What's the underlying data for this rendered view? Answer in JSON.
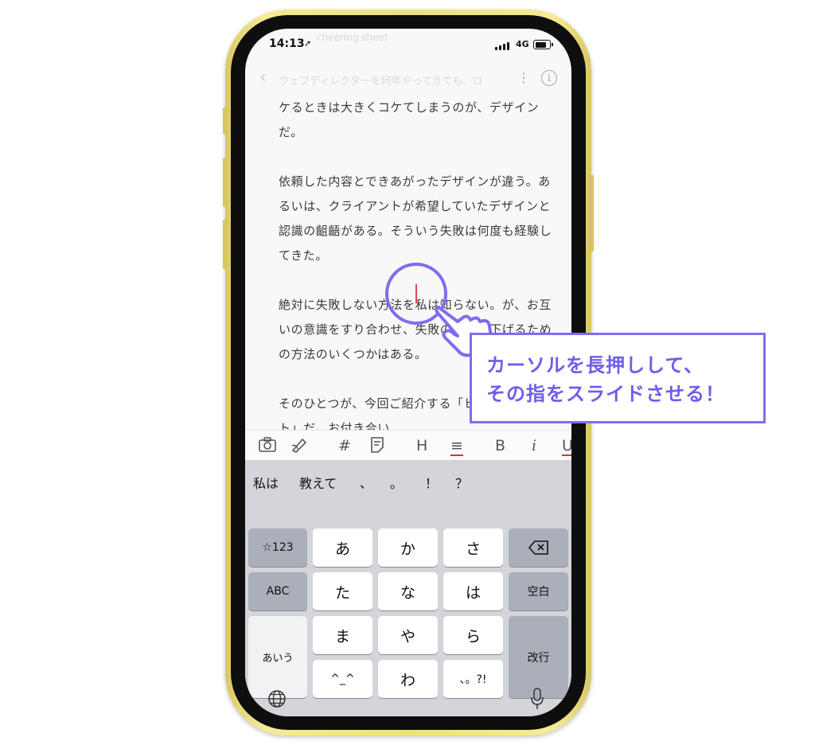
{
  "status_bar": {
    "time": "14:13",
    "network": "4G",
    "ghost_text": "cheering sheet"
  },
  "nav": {
    "title": "ウェブディレクターを何年やってきても、ロ"
  },
  "article": {
    "paragraphs": [
      "ケるときは大きくコケてしまうのが、デザインだ。",
      "依頼した内容とできあがったデザインが違う。あるいは、クライアントが希望していたデザインと認識の齟齬がある。そういう失敗は何度も経験してきた。",
      "絶対に失敗しない方法を私は知らない。が、お互いの意識をすり合わせ、失敗の確率を下げるための方法のいくつかはある。",
      "そのひとつが、今回ご紹介する「ヒアリングシート」だ。お付き合い"
    ]
  },
  "format_toolbar": {
    "items": [
      {
        "icon": "camera-icon",
        "label": ""
      },
      {
        "icon": "pen-icon",
        "label": ""
      },
      {
        "icon": "hashtag-icon",
        "label": "#"
      },
      {
        "icon": "note-icon",
        "label": ""
      },
      {
        "icon": "heading-icon",
        "label": "H"
      },
      {
        "icon": "list-icon",
        "label": "≡"
      },
      {
        "icon": "bold-icon",
        "label": "B"
      },
      {
        "icon": "italic-icon",
        "label": "i"
      },
      {
        "icon": "underline-icon",
        "label": "U"
      }
    ]
  },
  "keyboard": {
    "candidates": [
      "私は",
      "教えて",
      "、",
      "。",
      "！",
      "？"
    ],
    "keys": {
      "symbols": "☆123",
      "abc": "ABC",
      "kana": "あいう",
      "a": "あ",
      "ka": "か",
      "sa": "さ",
      "ta": "た",
      "na": "な",
      "ha": "は",
      "ma": "ま",
      "ya": "や",
      "ra": "ら",
      "emoticon": "^_^",
      "wa": "わ",
      "punct": "、。?!",
      "space": "空白",
      "return": "改行"
    }
  },
  "annotation": {
    "line1": "カーソルを長押しして、",
    "line2": "その指をスライドさせる！",
    "accent_color": "#7d6df0"
  }
}
